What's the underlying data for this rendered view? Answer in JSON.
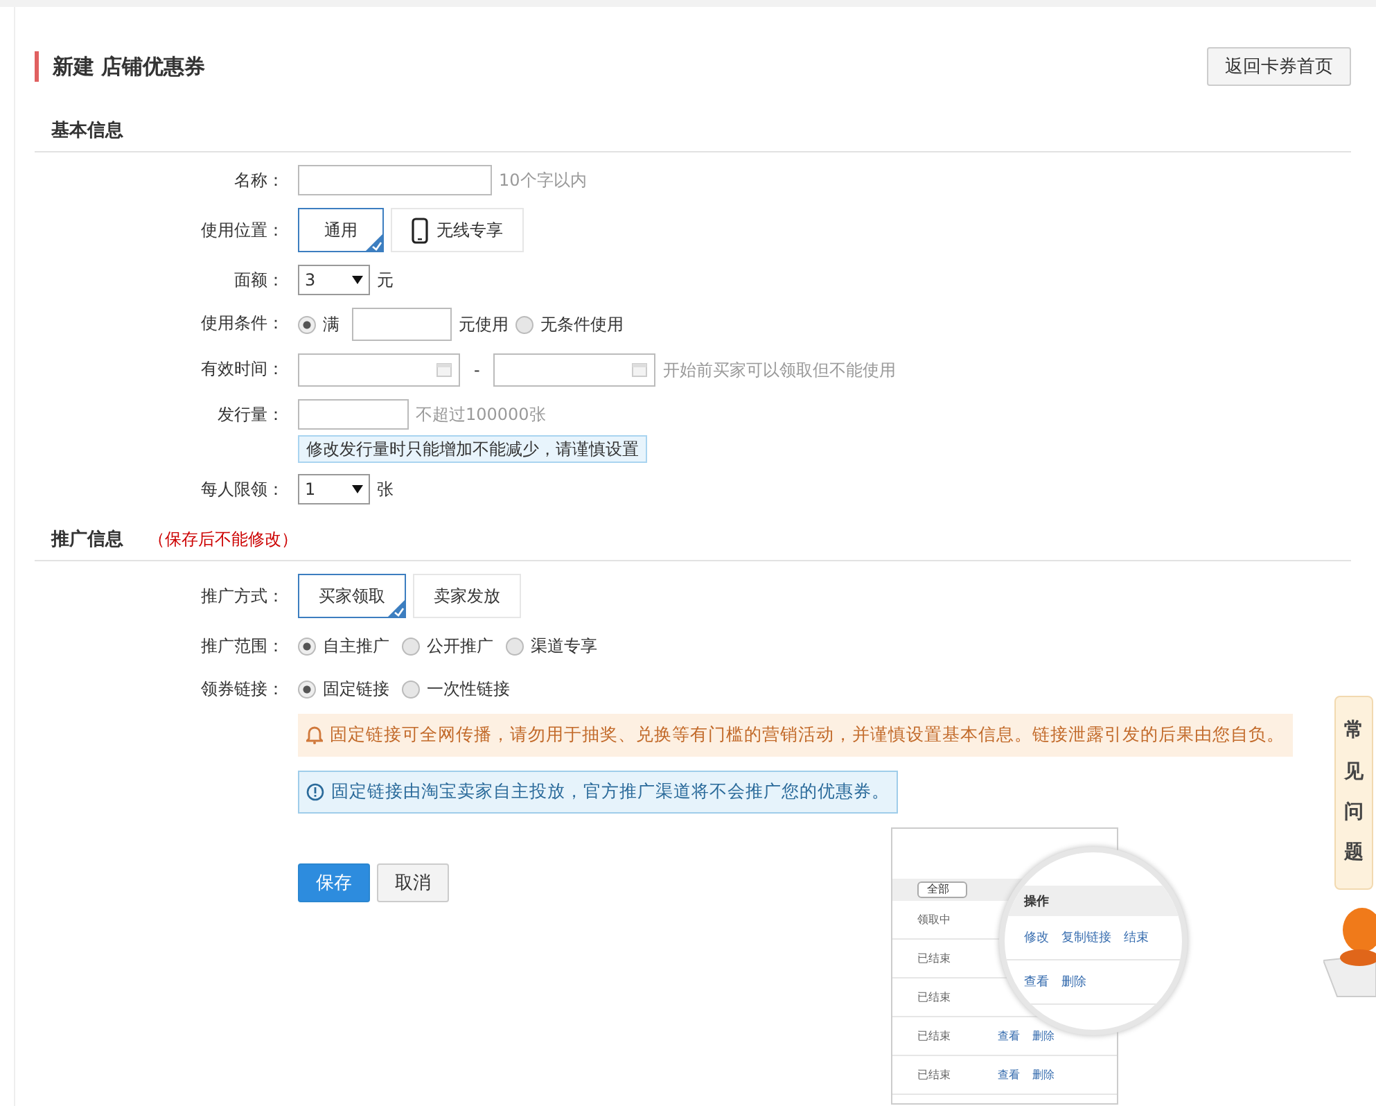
{
  "page": {
    "title": "新建 店铺优惠券",
    "back_button": "返回卡券首页"
  },
  "sections": [
    {
      "title": "基本信息",
      "fields": [
        {
          "kind": "text",
          "label": "名称：",
          "hint": "10个字以内"
        },
        {
          "kind": "cards",
          "label": "使用位置：",
          "options": [
            {
              "label": "通用",
              "selected": true,
              "kind": "plain"
            },
            {
              "label": "无线专享",
              "selected": false,
              "kind": "phone"
            }
          ]
        },
        {
          "kind": "select",
          "label": "面额：",
          "value": "3",
          "unit": "元"
        },
        {
          "kind": "radios",
          "label": "使用条件：",
          "options": [
            {
              "label": "满",
              "selected": true,
              "suffix": "元使用"
            },
            {
              "label": "无条件使用",
              "selected": false
            }
          ]
        },
        {
          "kind": "date_range",
          "label": "有效时间：",
          "separator": "-",
          "hint": "开始前买家可以领取但不能使用"
        },
        {
          "kind": "text",
          "label": "发行量：",
          "hint": "不超过100000张",
          "note": "修改发行量时只能增加不能减少，请谨慎设置"
        },
        {
          "kind": "select",
          "label": "每人限领：",
          "value": "1",
          "unit": "张"
        }
      ]
    },
    {
      "title": "推广信息",
      "note": "（保存后不能修改）",
      "fields": [
        {
          "kind": "cards",
          "label": "推广方式：",
          "options": [
            {
              "label": "买家领取",
              "selected": true,
              "kind": "plain"
            },
            {
              "label": "卖家发放",
              "selected": false,
              "kind": "plain"
            }
          ]
        },
        {
          "kind": "radios",
          "label": "推广范围：",
          "options": [
            {
              "label": "自主推广",
              "selected": true
            },
            {
              "label": "公开推广",
              "selected": false
            },
            {
              "label": "渠道专享",
              "selected": false
            }
          ]
        },
        {
          "kind": "radios",
          "label": "领券链接：",
          "options": [
            {
              "label": "固定链接",
              "selected": true
            },
            {
              "label": "一次性链接",
              "selected": false
            }
          ]
        }
      ]
    }
  ],
  "notices": [
    {
      "kind": "warning",
      "text": "固定链接可全网传播，请勿用于抽奖、兑换等有门槛的营销活动，并谨慎设置基本信息。链接泄露引发的后果由您自负。"
    },
    {
      "kind": "info",
      "text": "固定链接由淘宝卖家自主投放，官方推广渠道将不会推广您的优惠券。"
    }
  ],
  "buttons": [
    {
      "label": "保存",
      "kind": "primary"
    },
    {
      "label": "取消",
      "kind": "default"
    }
  ],
  "preview": {
    "filter": "全部",
    "rows": [
      {
        "status": "领取中",
        "actions": []
      },
      {
        "status": "已结束",
        "actions": []
      },
      {
        "status": "已结束",
        "actions": []
      },
      {
        "status": "已结束",
        "actions": [
          "查看",
          "删除"
        ]
      },
      {
        "status": "已结束",
        "actions": [
          "查看",
          "删除"
        ]
      }
    ],
    "magnifier": {
      "header": "操作",
      "rows": [
        [
          "修改",
          "复制链接",
          "结束"
        ],
        [
          "查看",
          "删除"
        ]
      ]
    }
  },
  "faq": "常见问题"
}
